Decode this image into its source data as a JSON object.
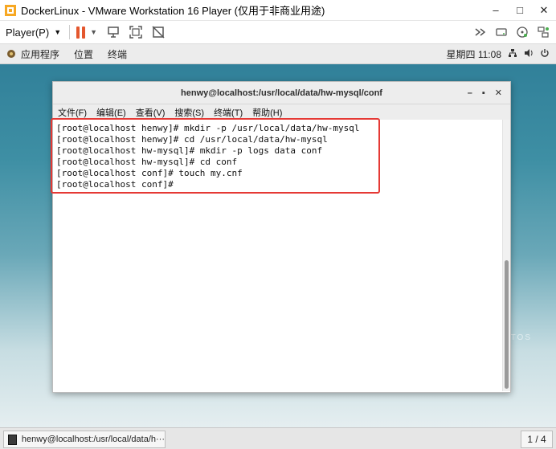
{
  "vm_window": {
    "title": "DockerLinux - VMware Workstation 16 Player (仅用于非商业用途)",
    "minimize": "–",
    "maximize": "□",
    "close": "✕"
  },
  "vm_toolbar": {
    "player_menu": "Player(P)",
    "icons": [
      "pause-icon",
      "send-ctrl-alt-del-icon",
      "fullscreen-icon",
      "unity-icon",
      "fast-forward-icon",
      "removable-devices-icon",
      "cd-icon",
      "network-icon"
    ]
  },
  "gnome_bar": {
    "menus": [
      "应用程序",
      "位置",
      "终端"
    ],
    "clock": "星期四 11:08"
  },
  "terminal": {
    "title": "henwy@localhost:/usr/local/data/hw-mysql/conf",
    "menu": [
      "文件(F)",
      "编辑(E)",
      "查看(V)",
      "搜索(S)",
      "终端(T)",
      "帮助(H)"
    ],
    "lines": [
      "[root@localhost henwy]# mkdir -p /usr/local/data/hw-mysql",
      "[root@localhost henwy]# cd /usr/local/data/hw-mysql",
      "[root@localhost hw-mysql]# mkdir -p logs data conf",
      "[root@localhost hw-mysql]# cd conf",
      "[root@localhost conf]# touch my.cnf",
      "[root@localhost conf]# "
    ]
  },
  "taskbar": {
    "task_label": "henwy@localhost:/usr/local/data/h···",
    "workspace": "1 / 4"
  },
  "colors": {
    "highlight": "#e53935",
    "pause": "#e4572e"
  }
}
